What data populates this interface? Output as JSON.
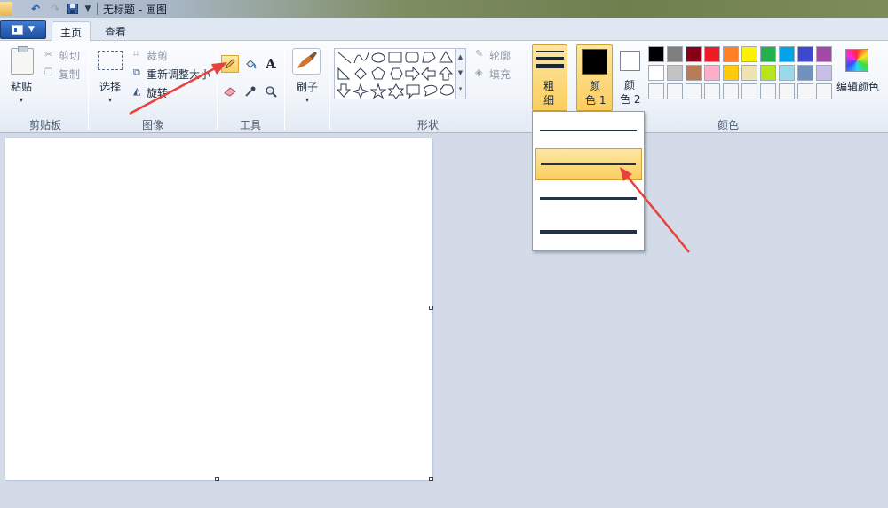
{
  "window": {
    "title": "无标题 - 画图"
  },
  "quick_access": {
    "app_icon": "paint-app-icon",
    "undo_icon": "undo-icon",
    "redo_icon": "redo-icon",
    "save_icon": "save-icon",
    "customize_icon": "dropdown-arrow-icon"
  },
  "tabs": [
    {
      "label": "主页",
      "active": true
    },
    {
      "label": "查看",
      "active": false
    }
  ],
  "groups": {
    "clipboard": {
      "label": "剪贴板",
      "paste": "粘贴",
      "cut": "剪切",
      "copy": "复制"
    },
    "image": {
      "label": "图像",
      "select": "选择",
      "crop": "裁剪",
      "resize": "重新调整大小",
      "rotate": "旋转"
    },
    "tools": {
      "label": "工具"
    },
    "brushes": {
      "label": "刷子"
    },
    "shapes": {
      "label": "形状",
      "outline": "轮廓",
      "fill": "填充"
    },
    "size": {
      "label_1": "粗",
      "label_2": "细"
    },
    "color1": {
      "label_1": "颜",
      "label_2": "色 1",
      "value": "#000000"
    },
    "color2": {
      "label_1": "颜",
      "label_2": "色 2",
      "value": "#ffffff"
    },
    "colors": {
      "label": "颜色",
      "edit": "编辑颜色",
      "palette_row1": [
        "#000000",
        "#7f7f7f",
        "#880015",
        "#ed1c24",
        "#ff7f27",
        "#fff200",
        "#22b14c",
        "#00a2e8",
        "#3f48cc",
        "#a349a4"
      ],
      "palette_row2": [
        "#ffffff",
        "#c3c3c3",
        "#b97a57",
        "#ffaec9",
        "#ffc90e",
        "#efe4b0",
        "#b5e61d",
        "#99d9ea",
        "#7092be",
        "#c8bfe7"
      ],
      "palette_row3": [
        "#f5f6f8",
        "#f5f6f8",
        "#f5f6f8",
        "#f5f6f8",
        "#f5f6f8",
        "#f5f6f8",
        "#f5f6f8",
        "#f5f6f8",
        "#f5f6f8",
        "#f5f6f8"
      ]
    }
  },
  "size_options": [
    {
      "name": "size-1px",
      "selected": false
    },
    {
      "name": "size-3px",
      "selected": true
    },
    {
      "name": "size-5px",
      "selected": false
    },
    {
      "name": "size-8px",
      "selected": false
    }
  ],
  "selected_tool": "pencil",
  "accent": {
    "highlight": "#fbcd5e",
    "annotation_arrow": "#e8413c"
  }
}
